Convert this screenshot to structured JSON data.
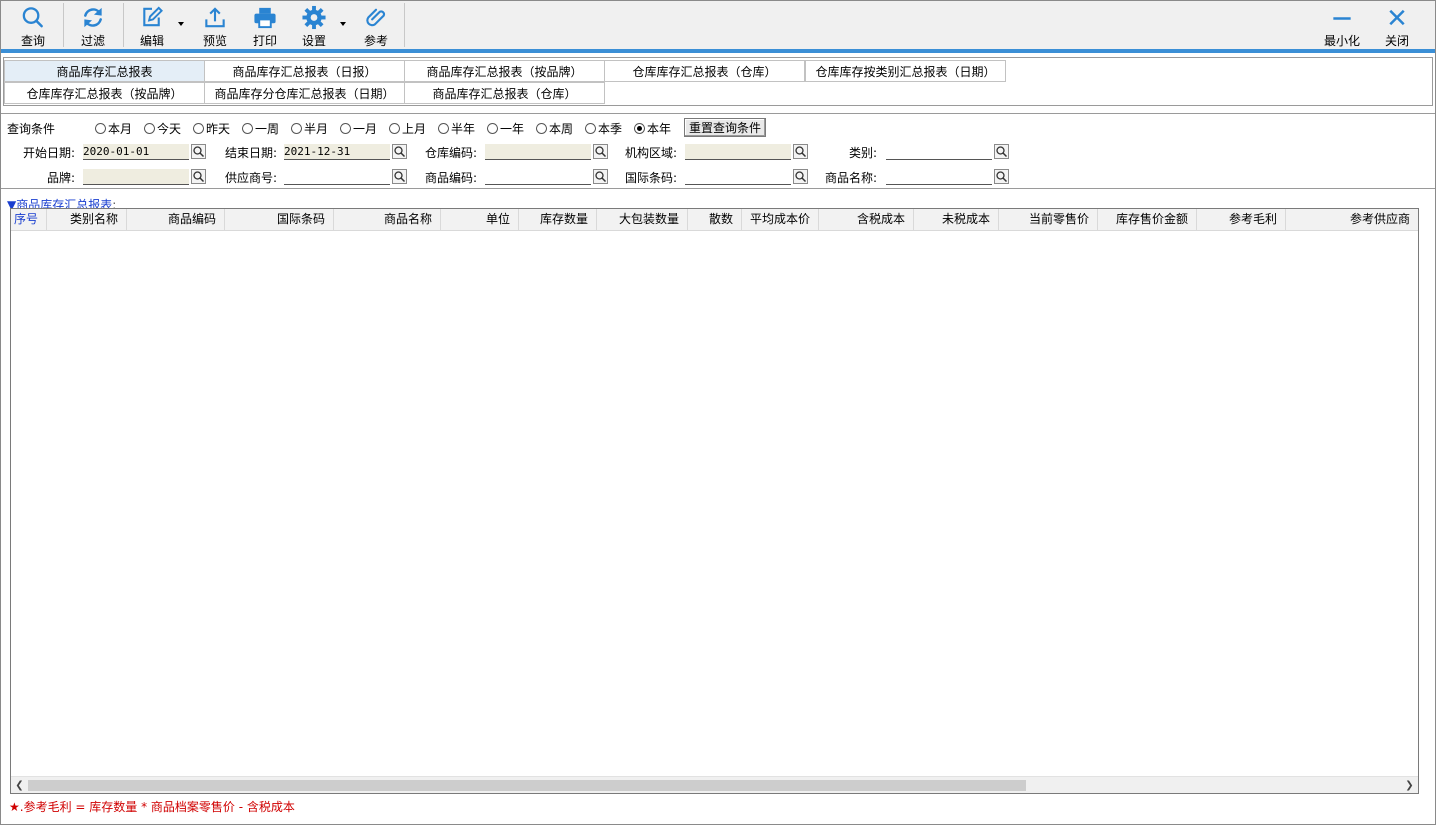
{
  "toolbar": {
    "query": "查询",
    "filter": "过滤",
    "edit": "编辑",
    "preview": "预览",
    "print": "打印",
    "settings": "设置",
    "reference": "参考",
    "minimize": "最小化",
    "close": "关闭",
    "accent_color": "#3b8fd6"
  },
  "report_tabs": [
    {
      "label": "商品库存汇总报表",
      "active": true
    },
    {
      "label": "商品库存汇总报表（日报）"
    },
    {
      "label": "商品库存汇总报表（按品牌）"
    },
    {
      "label": "仓库库存汇总报表（仓库）"
    },
    {
      "label": "仓库库存按类别汇总报表（日期）"
    },
    {
      "label": "仓库库存汇总报表（按品牌）"
    },
    {
      "label": "商品库存分仓库汇总报表（日期）"
    },
    {
      "label": "商品库存汇总报表（仓库）"
    }
  ],
  "query": {
    "title": "查询条件",
    "periods": [
      "本月",
      "今天",
      "昨天",
      "一周",
      "半月",
      "一月",
      "上月",
      "半年",
      "一年",
      "本周",
      "本季",
      "本年"
    ],
    "selected_period": "本年",
    "reset_button": "重置查询条件",
    "fields": {
      "start_date": {
        "label": "开始日期:",
        "value": "2020-01-01"
      },
      "end_date": {
        "label": "结束日期:",
        "value": "2021-12-31"
      },
      "warehouse_code": {
        "label": "仓库编码:",
        "value": ""
      },
      "org_region": {
        "label": "机构区域:",
        "value": ""
      },
      "category": {
        "label": "类别:",
        "value": ""
      },
      "brand": {
        "label": "品牌:",
        "value": ""
      },
      "supplier_no": {
        "label": "供应商号:",
        "value": ""
      },
      "product_code": {
        "label": "商品编码:",
        "value": ""
      },
      "barcode": {
        "label": "国际条码:",
        "value": ""
      },
      "product_name": {
        "label": "商品名称:",
        "value": ""
      }
    }
  },
  "grid": {
    "caption": "商品库存汇总报表",
    "columns": [
      "序号",
      "类别名称",
      "商品编码",
      "国际条码",
      "商品名称",
      "单位",
      "库存数量",
      "大包装数量",
      "散数",
      "平均成本价",
      "含税成本",
      "未税成本",
      "当前零售价",
      "库存售价金额",
      "参考毛利",
      "参考供应商"
    ],
    "rows": []
  },
  "footnote": {
    "star": "★",
    "text": ".参考毛利 = 库存数量 * 商品档案零售价 - 含税成本",
    "color": "#d00000"
  }
}
